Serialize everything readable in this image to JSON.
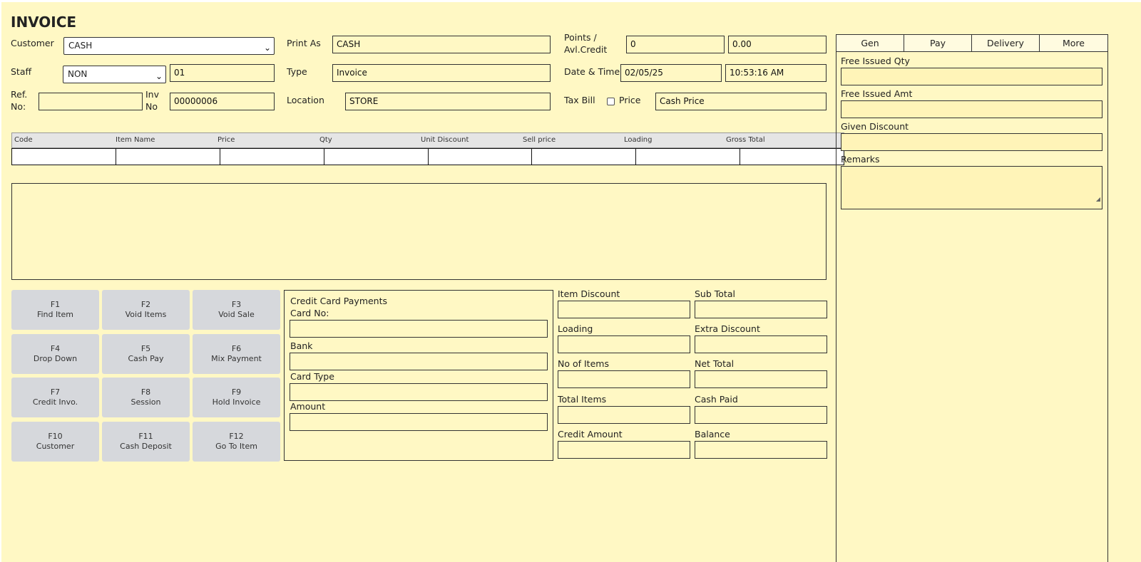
{
  "page": {
    "title": "INVOICE"
  },
  "form": {
    "customer_label": "Customer",
    "customer_value": "CASH",
    "print_as_label": "Print As",
    "print_as_value": "CASH",
    "points_label_1": "Points /",
    "points_label_2": "Avl.Credit",
    "points_value": "0",
    "credit_value": "0.00",
    "staff_label": "Staff",
    "staff_value": "NON",
    "staff_code": "01",
    "type_label": "Type",
    "type_value": "Invoice",
    "datetime_label": "Date & Time",
    "date_value": "02/05/25",
    "time_value": "10:53:16 AM",
    "ref_label_1": "Ref.",
    "ref_label_2": "No:",
    "ref_value": "",
    "inv_label_1": "Inv",
    "inv_label_2": "No",
    "inv_value": "00000006",
    "location_label": "Location",
    "location_value": "STORE",
    "taxbill_label": "Tax Bill",
    "price_label": "Price",
    "price_value": "Cash Price"
  },
  "grid": {
    "columns": [
      "Code",
      "Item Name",
      "Price",
      "Qty",
      "Unit Discount",
      "Sell price",
      "Loading",
      "Gross Total"
    ]
  },
  "fkeys": [
    {
      "key": "F1",
      "label": "Find Item"
    },
    {
      "key": "F2",
      "label": "Void Items"
    },
    {
      "key": "F3",
      "label": "Void Sale"
    },
    {
      "key": "F4",
      "label": "Drop Down"
    },
    {
      "key": "F5",
      "label": "Cash Pay"
    },
    {
      "key": "F6",
      "label": "Mix Payment"
    },
    {
      "key": "F7",
      "label": "Credit Invo."
    },
    {
      "key": "F8",
      "label": "Session"
    },
    {
      "key": "F9",
      "label": "Hold Invoice"
    },
    {
      "key": "F10",
      "label": "Customer"
    },
    {
      "key": "F11",
      "label": "Cash Deposit"
    },
    {
      "key": "F12",
      "label": "Go To Item"
    }
  ],
  "credit_card": {
    "title": "Credit Card Payments",
    "card_no_label": "Card No:",
    "bank_label": "Bank",
    "card_type_label": "Card Type",
    "amount_label": "Amount"
  },
  "totals": {
    "item_discount": "Item Discount",
    "sub_total": "Sub Total",
    "loading": "Loading",
    "extra_discount": "Extra Discount",
    "no_of_items": "No of Items",
    "net_total": "Net Total",
    "total_items": "Total Items",
    "cash_paid": "Cash Paid",
    "credit_amount": "Credit Amount",
    "balance": "Balance"
  },
  "side": {
    "tabs": [
      "Gen",
      "Pay",
      "Delivery",
      "More"
    ],
    "free_qty_label": "Free Issued Qty",
    "free_amt_label": "Free Issued Amt",
    "given_discount_label": "Given Discount",
    "remarks_label": "Remarks"
  },
  "colors": {
    "background": "#fff8c4",
    "fkey_bg": "#d6d8dc",
    "grid_head": "#e5e5e5"
  }
}
